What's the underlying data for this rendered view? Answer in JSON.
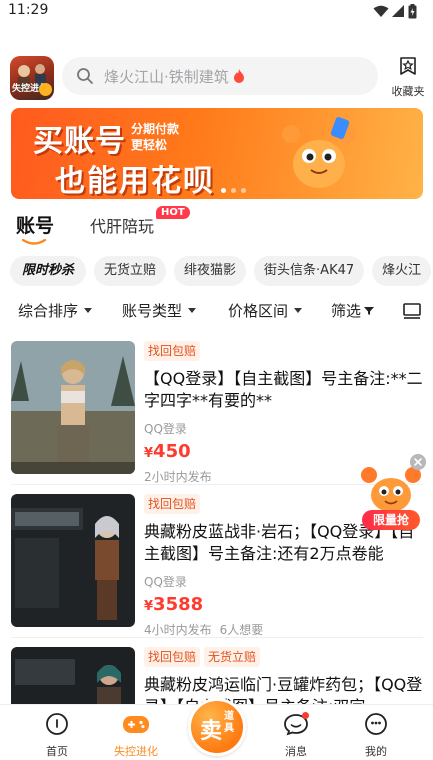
{
  "status_bar": {
    "time": "11:29"
  },
  "header": {
    "app_logo_text": "失控进化",
    "search_placeholder": "烽火江山·铁制建筑",
    "favorites_label": "收藏夹"
  },
  "banner": {
    "title": "买账号",
    "subtitle_line1": "分期付款",
    "subtitle_line2": "更轻松",
    "headline": "也能用花呗"
  },
  "tabs": {
    "account": "账号",
    "service": "代肝陪玩",
    "hot_badge": "HOT"
  },
  "quick_tags": [
    "限时秒杀",
    "无货立赔",
    "绯夜猫影",
    "街头信条·AK47",
    "烽火江"
  ],
  "filters": {
    "sort": "综合排序",
    "type": "账号类型",
    "price": "价格区间",
    "screen": "筛选"
  },
  "listings": [
    {
      "badges": [
        "找回包赔"
      ],
      "title": "【QQ登录】【自主截图】号主备注:**二字四字**有要的**",
      "login": "QQ登录",
      "currency": "¥",
      "price": "450",
      "time": "2小时内发布",
      "wants": ""
    },
    {
      "badges": [
        "找回包赔"
      ],
      "title": "典藏粉皮蓝战非·岩石；【QQ登录】【自主截图】号主备注:还有2万点卷能",
      "login": "QQ登录",
      "currency": "¥",
      "price": "3588",
      "time": "4小时内发布",
      "wants": "6人想要"
    },
    {
      "badges": [
        "找回包赔",
        "无货立赔"
      ],
      "title": "典藏粉皮鸿运临门·豆罐炸药包；【QQ登录】【自主截图】号主备注:双字",
      "login": "",
      "currency": "",
      "price": "",
      "time": "",
      "wants": ""
    }
  ],
  "float_promo": {
    "label": "限量抢"
  },
  "bottom_nav": {
    "home": "首页",
    "game": "失控进化",
    "sell_main": "卖",
    "sell_sub": "道具",
    "messages": "消息",
    "mine": "我的"
  },
  "colors": {
    "accent": "#ff7a12",
    "price": "#ff3b2f",
    "badge_text": "#e0521f"
  }
}
